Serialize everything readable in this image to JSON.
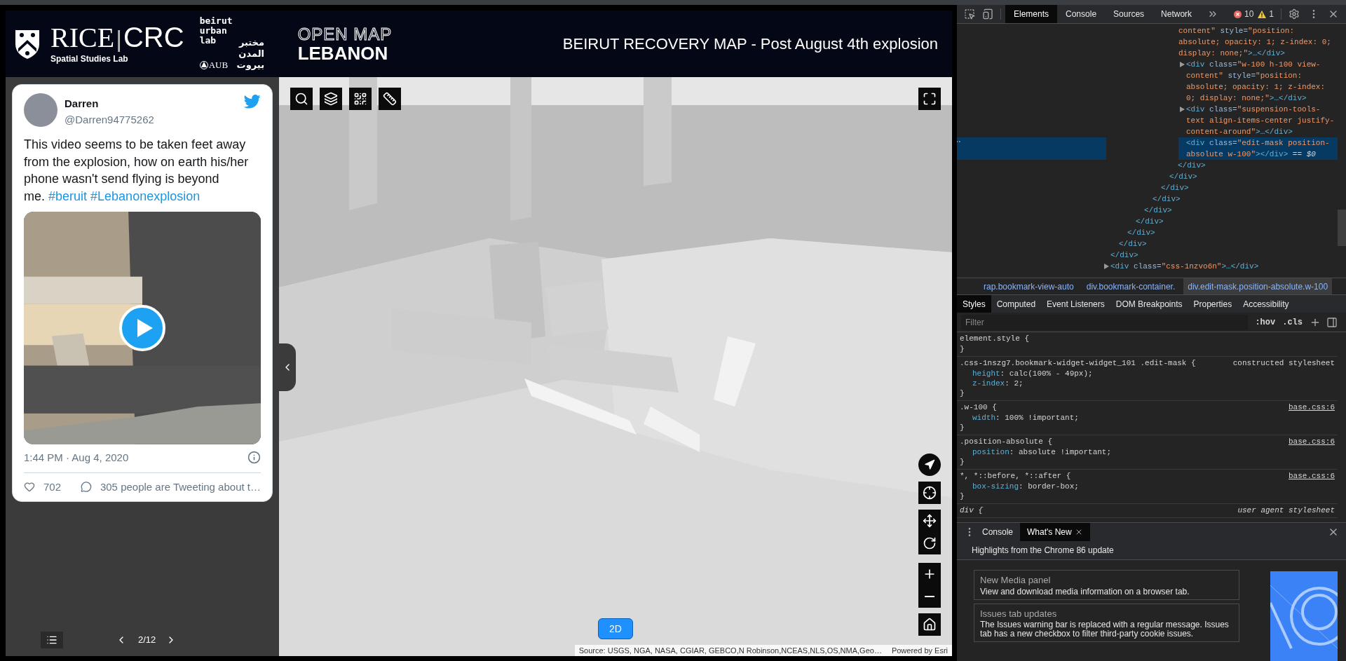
{
  "header": {
    "rice": {
      "name": "RICE",
      "divider": "|",
      "crc": "CRC",
      "lab": "Spatial Studies Lab"
    },
    "bul": {
      "lines": [
        "beirut",
        "urban",
        "lab"
      ],
      "arabic": [
        "مختبر",
        "المدن",
        "بيروت"
      ],
      "aub": "AUB"
    },
    "oml": {
      "top": "OPEN MAP",
      "bottom": "LEBANON"
    },
    "title": "BEIRUT RECOVERY MAP - Post August 4th explosion"
  },
  "tweet": {
    "name": "Darren",
    "handle": "@Darren94775262",
    "text": "This video seems to be taken feet away from the explosion, how on earth his/her phone wasn't send flying is beyond me.",
    "hashtags": [
      "#beruit",
      "#Lebanonexplosion"
    ],
    "time": "1:44 PM · Aug 4, 2020",
    "likes": "702",
    "conversation": "305 people are Tweeting about t…"
  },
  "pager": {
    "page": "2/12"
  },
  "map": {
    "view_button": "2D",
    "attribution": "Source: USGS, NGA, NASA, CGIAR, GEBCO,N Robinson,NCEAS,NLS,OS,NMA,Geo…",
    "powered_by": "Powered by Esri"
  },
  "devtools": {
    "tabs": [
      {
        "label": "Elements",
        "selected": true
      },
      {
        "label": "Console",
        "selected": false
      },
      {
        "label": "Sources",
        "selected": false
      },
      {
        "label": "Network",
        "selected": false
      }
    ],
    "errors": "10",
    "warnings": "1",
    "dom_tree": [
      {
        "kind": "container",
        "close": "</div>",
        "children": [
          {
            "kind": "container",
            "close": "</div>",
            "children": [
              {
                "kind": "container",
                "close": "</div>",
                "children": [
                  {
                    "kind": "container",
                    "close": "</div>",
                    "children": [
                      {
                        "kind": "container",
                        "close": "</div>",
                        "children": [
                          {
                            "kind": "container",
                            "close": "</div>",
                            "children": [
                              {
                                "kind": "container",
                                "close": "</div>",
                                "children": [
                                  {
                                    "kind": "container",
                                    "close": "</div>",
                                    "children": [
                                      {
                                        "kind": "container",
                                        "close": "</div>",
                                        "children": [
                                          {
                                            "kind": "tail",
                                            "segments": [
                                              {
                                                "kind": "value",
                                                "text": "content\""
                                              },
                                              {
                                                "kind": "attr",
                                                "text": " style="
                                              },
                                              {
                                                "kind": "value",
                                                "text": "\"position: absolute; opacity: 1; z-index: 0; display: none;\""
                                              },
                                              {
                                                "kind": "tag",
                                                "text": ">…</div>"
                                              }
                                            ]
                                          },
                                          {
                                            "kind": "element",
                                            "expanded": false,
                                            "selected": false,
                                            "segments": [
                                              {
                                                "kind": "tag",
                                                "text": "<div"
                                              },
                                              {
                                                "kind": "attr",
                                                "text": " class="
                                              },
                                              {
                                                "kind": "value",
                                                "text": "\"w-100 h-100 view-content\""
                                              },
                                              {
                                                "kind": "attr",
                                                "text": " style="
                                              },
                                              {
                                                "kind": "value",
                                                "text": "\"position: absolute; opacity: 1; z-index: 0; display: none;\""
                                              },
                                              {
                                                "kind": "tag",
                                                "text": ">…</div>"
                                              }
                                            ]
                                          },
                                          {
                                            "kind": "element",
                                            "expanded": false,
                                            "selected": false,
                                            "segments": [
                                              {
                                                "kind": "tag",
                                                "text": "<div"
                                              },
                                              {
                                                "kind": "attr",
                                                "text": " class="
                                              },
                                              {
                                                "kind": "value",
                                                "text": "\"suspension-tools-text align-items-center justify-content-around\""
                                              },
                                              {
                                                "kind": "tag",
                                                "text": ">…</div>"
                                              }
                                            ]
                                          },
                                          {
                                            "kind": "leaf",
                                            "selected": true,
                                            "segments": [
                                              {
                                                "kind": "tag",
                                                "text": "<div"
                                              },
                                              {
                                                "kind": "attr",
                                                "text": " class="
                                              },
                                              {
                                                "kind": "value",
                                                "text": "\"edit-mask position-absolute w-100\""
                                              },
                                              {
                                                "kind": "tag",
                                                "text": "></div>"
                                              },
                                              {
                                                "kind": "plain",
                                                "text": " == $0"
                                              }
                                            ]
                                          }
                                        ]
                                      }
                                    ]
                                  }
                                ]
                              }
                            ]
                          }
                        ]
                      }
                    ]
                  }
                ]
              }
            ]
          }
        ]
      },
      {
        "kind": "element",
        "expanded": false,
        "selected": false,
        "segments": [
          {
            "kind": "tag",
            "text": "<div"
          },
          {
            "kind": "attr",
            "text": " class="
          },
          {
            "kind": "value",
            "text": "\"css-1nzvo6n\""
          },
          {
            "kind": "tag",
            "text": ">…</div>"
          }
        ]
      }
    ],
    "breadcrumbs": [
      {
        "label": "rap.bookmark-view-auto",
        "selected": false
      },
      {
        "label": "div.bookmark-container.",
        "selected": false
      },
      {
        "label": "div.edit-mask.position-absolute.w-100",
        "selected": true
      }
    ],
    "style_tabs": [
      {
        "label": "Styles",
        "selected": true
      },
      {
        "label": "Computed",
        "selected": false
      },
      {
        "label": "Event Listeners",
        "selected": false
      },
      {
        "label": "DOM Breakpoints",
        "selected": false
      },
      {
        "label": "Properties",
        "selected": false
      },
      {
        "label": "Accessibility",
        "selected": false
      }
    ],
    "filter": {
      "placeholder": "Filter"
    },
    "hov": ":hov",
    "cls": ".cls",
    "rules": [
      {
        "kind": "inline",
        "selector": "element.style {",
        "close": "}"
      },
      {
        "kind": "author",
        "selector": ".css-1nszg7.bookmark-widget-widget_101 .edit-mask {",
        "source": "constructed stylesheet",
        "close": "}",
        "declarations": [
          {
            "prop": "height",
            "value": ": calc(100% - 49px);"
          },
          {
            "prop": "z-index",
            "value": ": 2;"
          }
        ]
      },
      {
        "kind": "link",
        "selector": ".w-100 {",
        "source": "base.css:6",
        "close": "}",
        "declarations": [
          {
            "prop": "width",
            "value": ": 100% !important;"
          }
        ]
      },
      {
        "kind": "link",
        "selector": ".position-absolute {",
        "source": "base.css:6",
        "close": "}",
        "declarations": [
          {
            "prop": "position",
            "value": ": absolute !important;"
          }
        ]
      },
      {
        "kind": "link",
        "selector": "*, *::before, *::after {",
        "source": "base.css:6",
        "close": "}",
        "declarations": [
          {
            "prop": "box-sizing",
            "value": ": border-box;"
          }
        ]
      },
      {
        "kind": "user_agent",
        "selector": "div {",
        "source": "user agent stylesheet"
      }
    ],
    "drawer_tabs": [
      {
        "label": "Console",
        "selected": false,
        "closable": false
      },
      {
        "label": "What's New",
        "selected": true,
        "closable": true
      }
    ],
    "whats_new": {
      "heading": "Highlights from the Chrome 86 update",
      "cards": [
        {
          "title": "New Media panel",
          "body": "View and download media information on a browser tab."
        },
        {
          "title": "Issues tab updates",
          "body": "The Issues warning bar is replaced with a regular message. Issues tab has a new checkbox to filter third-party cookie issues."
        }
      ]
    }
  }
}
